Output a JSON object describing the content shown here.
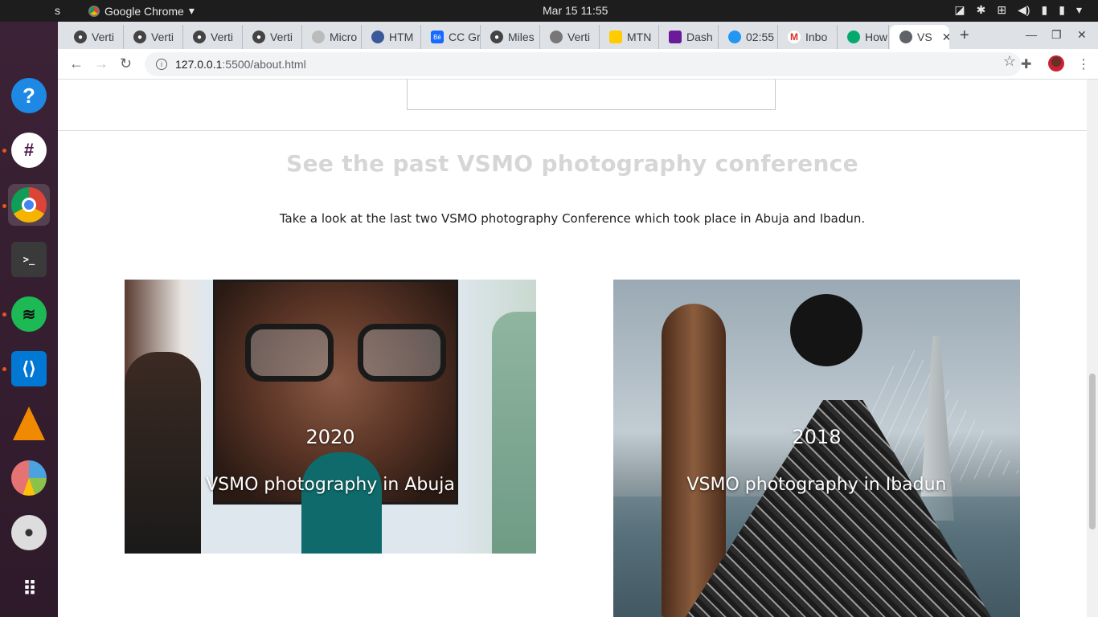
{
  "topbar": {
    "activities": "s",
    "app_name": "Google Chrome",
    "clock": "Mar 15  11:55"
  },
  "dock": {
    "items": [
      "help-icon",
      "slack-icon",
      "chrome-icon",
      "terminal-icon",
      "spotify-icon",
      "vscode-icon",
      "vlc-icon",
      "pie-app-icon",
      "disc-icon",
      "apps-grid-icon"
    ]
  },
  "tabs": [
    {
      "label": "Verti",
      "icon": "github-icon"
    },
    {
      "label": "Verti",
      "icon": "github-icon"
    },
    {
      "label": "Verti",
      "icon": "github-icon"
    },
    {
      "label": "Verti",
      "icon": "github-icon"
    },
    {
      "label": "Micro",
      "icon": "microsoft-icon"
    },
    {
      "label": "HTM",
      "icon": "person-icon"
    },
    {
      "label": "CC Gr",
      "icon": "behance-icon"
    },
    {
      "label": "Miles",
      "icon": "github-icon"
    },
    {
      "label": "Verti",
      "icon": "globe-icon"
    },
    {
      "label": "MTN",
      "icon": "mtn-icon"
    },
    {
      "label": "Dash",
      "icon": "dash-icon"
    },
    {
      "label": "02:55",
      "icon": "clock-icon"
    },
    {
      "label": "Inbo",
      "icon": "gmail-icon"
    },
    {
      "label": "How",
      "icon": "w3-icon"
    },
    {
      "label": "VS",
      "icon": "globe-icon",
      "active": true
    }
  ],
  "address": {
    "host": "127.0.0.1",
    "path": ":5500/about.html"
  },
  "page": {
    "section_title": "See the past VSMO photography conference",
    "intro": "Take a look at the last two VSMO photography Conference which took place in Abuja and Ibadun.",
    "cards": [
      {
        "year": "2020",
        "caption": "VSMO photography in Abuja"
      },
      {
        "year": "2018",
        "caption": "VSMO photography in Ibadun"
      }
    ]
  }
}
